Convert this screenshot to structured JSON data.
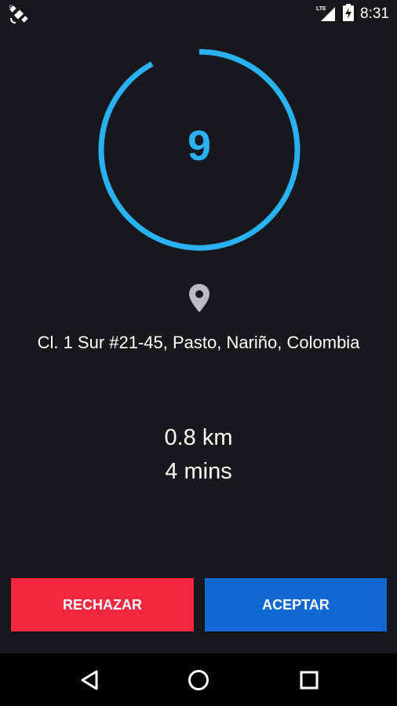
{
  "status_bar": {
    "network_label": "LTE",
    "time": "8:31",
    "icons": [
      "satellite-icon",
      "signal-icon",
      "battery-charging-icon"
    ]
  },
  "offer": {
    "countdown": "9",
    "countdown_remaining_fraction": 0.92,
    "accent_color": "#29b1f1",
    "address": "Cl. 1 Sur #21-45, Pasto, Nariño, Colombia",
    "distance": "0.8 km",
    "duration": "4 mins"
  },
  "actions": {
    "reject_label": "RECHAZAR",
    "reject_color": "#f1283f",
    "accept_label": "ACEPTAR",
    "accept_color": "#1069d2"
  },
  "nav_bar": {
    "icons": [
      "back-icon",
      "home-icon",
      "recents-icon"
    ]
  }
}
